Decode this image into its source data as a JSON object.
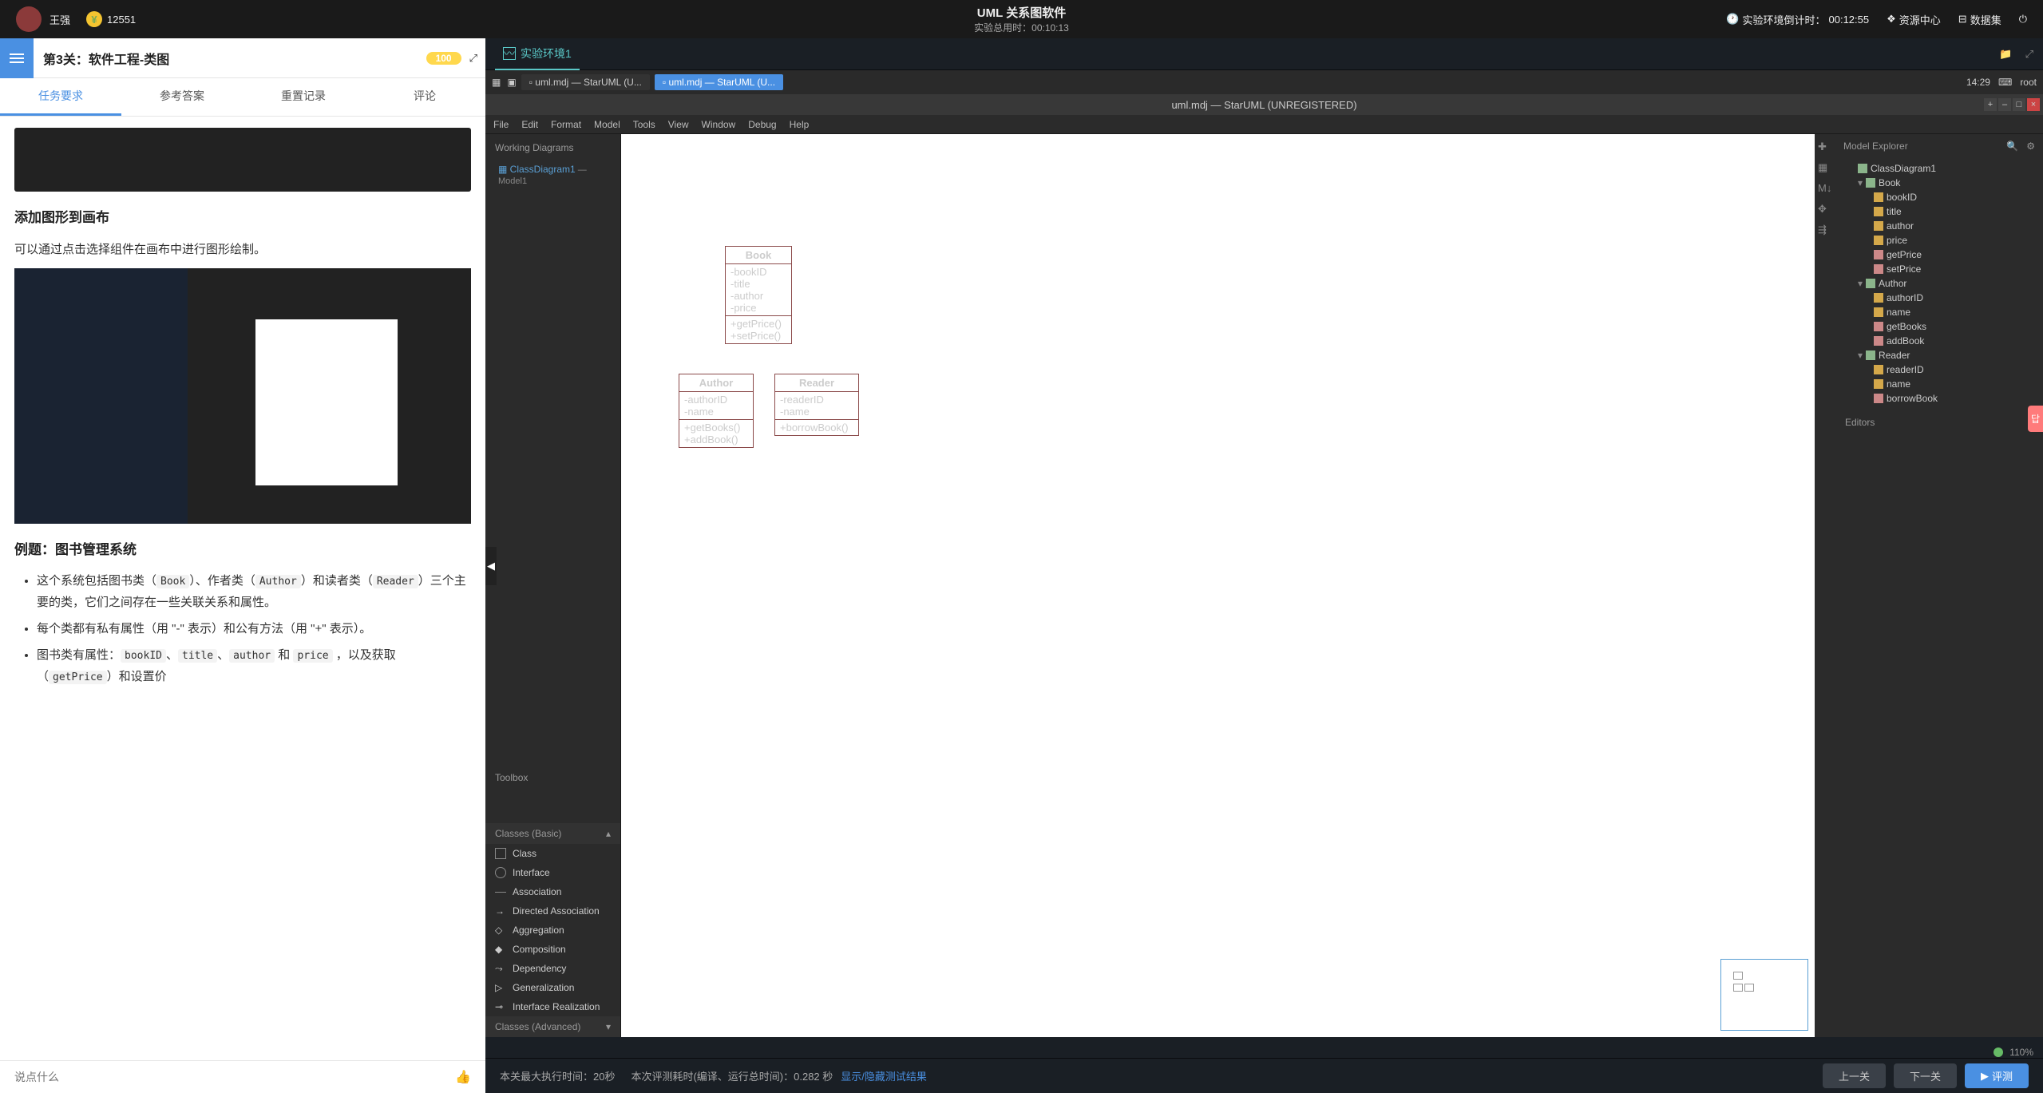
{
  "topbar": {
    "username": "王强",
    "coins": "12551",
    "app_title": "UML 关系图软件",
    "runtime_label": "实验总用时：",
    "runtime_val": "00:10:13",
    "countdown_label": "实验环境倒计时：",
    "countdown_val": "00:12:55",
    "resource": "资源中心",
    "dataset": "数据集"
  },
  "left": {
    "title": "第3关：软件工程-类图",
    "score": "100",
    "tabs": [
      "任务要求",
      "参考答案",
      "重置记录",
      "评论"
    ],
    "h1": "添加图形到画布",
    "p1": "可以通过点击选择组件在画布中进行图形绘制。",
    "h2": "例题：图书管理系统",
    "li1_a": "这个系统包括图书类（",
    "li1_b": "）、作者类（",
    "li1_c": "）和读者类（",
    "li1_d": "）三个主要的类，它们之间存在一些关联关系和属性。",
    "li2": "每个类都有私有属性（用 \"-\" 表示）和公有方法（用 \"+\" 表示）。",
    "li3_a": "图书类有属性：",
    "li3_b": "、",
    "li3_c": "、",
    "li3_d": " 和 ",
    "li3_e": " ，以及获取（",
    "li3_f": "）和设置价",
    "code": {
      "book": "Book",
      "author": "Author",
      "reader": "Reader",
      "bookID": "bookID",
      "title": "title",
      "authorf": "author",
      "price": "price",
      "getPrice": "getPrice"
    },
    "comment_ph": "说点什么"
  },
  "env": {
    "tab": "实验环境1"
  },
  "taskbar": {
    "app1": "uml.mdj — StarUML (U...",
    "app2": "uml.mdj — StarUML (U...",
    "time": "14:29",
    "user": "root"
  },
  "win": {
    "title": "uml.mdj — StarUML (UNREGISTERED)",
    "menu": [
      "File",
      "Edit",
      "Format",
      "Model",
      "Tools",
      "View",
      "Window",
      "Debug",
      "Help"
    ],
    "wd_h": "Working Diagrams",
    "wd_item": "ClassDiagram1",
    "wd_model": " — Model1",
    "tb_h": "Toolbox",
    "tb_sec1": "Classes (Basic)",
    "tb_items": [
      "Class",
      "Interface",
      "Association",
      "Directed Association",
      "Aggregation",
      "Composition",
      "Dependency",
      "Generalization",
      "Interface Realization"
    ],
    "tb_sec2": "Classes (Advanced)",
    "explorer": "Model Explorer",
    "editors": "Editors",
    "zoom": "110%"
  },
  "uml": {
    "book": {
      "name": "Book",
      "attrs": [
        "-bookID",
        "-title",
        "-author",
        "-price"
      ],
      "ops": [
        "+getPrice()",
        "+setPrice()"
      ]
    },
    "author": {
      "name": "Author",
      "attrs": [
        "-authorID",
        "-name"
      ],
      "ops": [
        "+getBooks()",
        "+addBook()"
      ]
    },
    "reader": {
      "name": "Reader",
      "attrs": [
        "-readerID",
        "-name"
      ],
      "ops": [
        "+borrowBook()"
      ]
    }
  },
  "tree": {
    "cd": "ClassDiagram1",
    "book": "Book",
    "book_a": [
      "bookID",
      "title",
      "author",
      "price",
      "getPrice",
      "setPrice"
    ],
    "author": "Author",
    "author_a": [
      "authorID",
      "name",
      "getBooks",
      "addBook"
    ],
    "reader": "Reader",
    "reader_a": [
      "readerID",
      "name",
      "borrowBook"
    ]
  },
  "bottom": {
    "exec": "本关最大执行时间：20秒",
    "eval": "本次评测耗时(编译、运行总时间)：0.282 秒",
    "toggle": "显示/隐藏测试结果",
    "prev": "上一关",
    "next": "下一关",
    "run": "评测"
  }
}
